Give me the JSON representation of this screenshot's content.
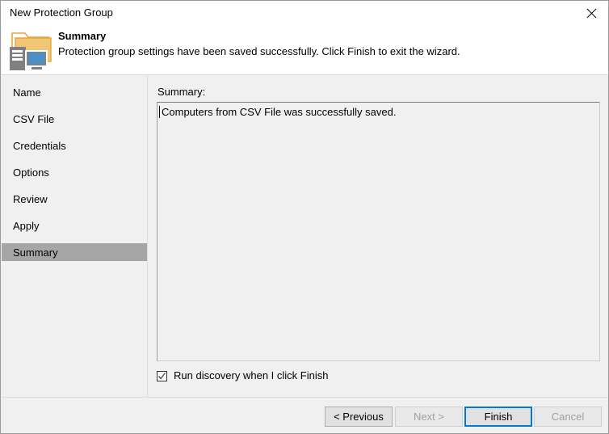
{
  "window": {
    "title": "New Protection Group",
    "close_icon": "close-icon"
  },
  "header": {
    "icon": "protection-group-folder-computer-icon",
    "title": "Summary",
    "subtitle": "Protection group settings have been saved successfully. Click Finish to exit the wizard."
  },
  "sidebar": {
    "items": [
      {
        "label": "Name",
        "selected": false
      },
      {
        "label": "CSV File",
        "selected": false
      },
      {
        "label": "Credentials",
        "selected": false
      },
      {
        "label": "Options",
        "selected": false
      },
      {
        "label": "Review",
        "selected": false
      },
      {
        "label": "Apply",
        "selected": false
      },
      {
        "label": "Summary",
        "selected": true
      }
    ],
    "selected_background": "#a6a6a6"
  },
  "content": {
    "summary_label": "Summary:",
    "summary_text": "Computers from CSV File was successfully saved.",
    "checkbox": {
      "label": "Run discovery when I click Finish",
      "checked": true,
      "check_icon": "checkmark-icon"
    }
  },
  "footer": {
    "buttons": [
      {
        "label": "< Previous",
        "state": "enabled"
      },
      {
        "label": "Next >",
        "state": "disabled"
      },
      {
        "label": "Finish",
        "state": "default"
      },
      {
        "label": "Cancel",
        "state": "disabled"
      }
    ],
    "focus_color": "#0078d7"
  }
}
